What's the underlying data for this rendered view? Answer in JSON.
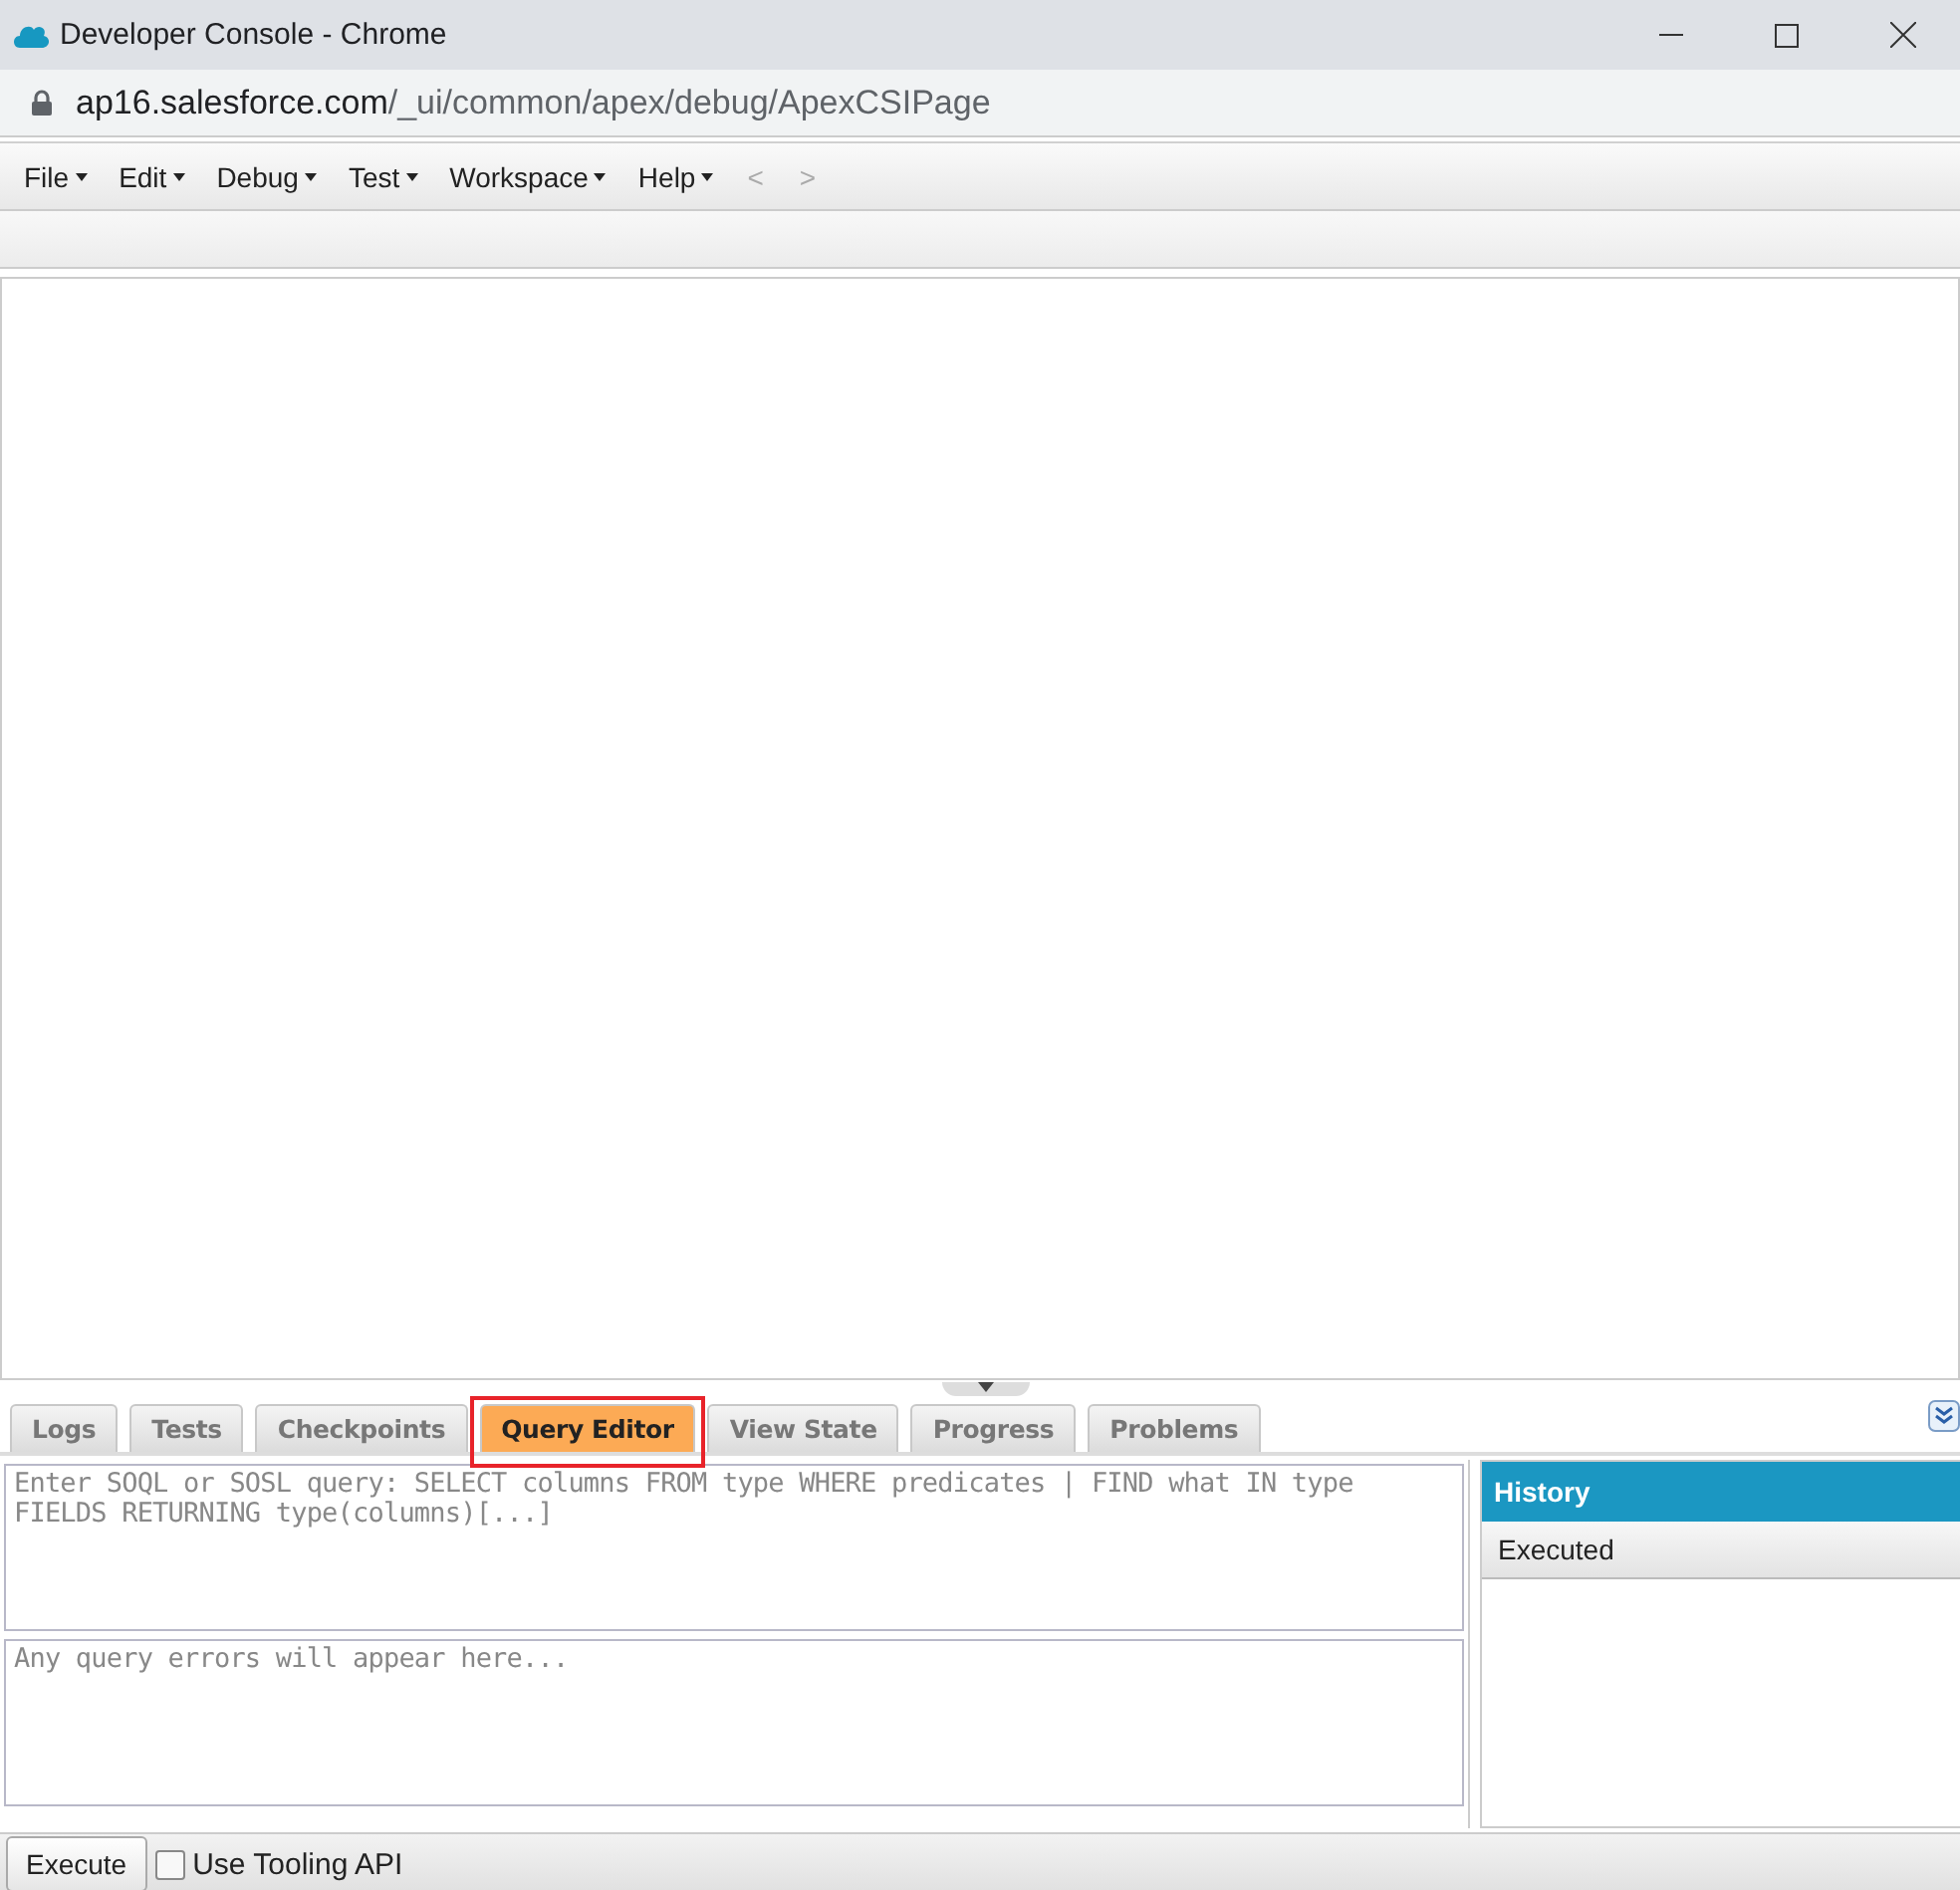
{
  "window": {
    "title": "Developer Console - Chrome",
    "url_host": "ap16.salesforce.com",
    "url_path": "/_ui/common/apex/debug/ApexCSIPage"
  },
  "menu": [
    {
      "label": "File"
    },
    {
      "label": "Edit"
    },
    {
      "label": "Debug"
    },
    {
      "label": "Test"
    },
    {
      "label": "Workspace"
    },
    {
      "label": "Help"
    }
  ],
  "nav": [
    {
      "label": "<",
      "disabled": true
    },
    {
      "label": ">",
      "disabled": true
    }
  ],
  "tabs": [
    {
      "label": "Logs",
      "selected": false,
      "highlighted": false
    },
    {
      "label": "Tests",
      "selected": false,
      "highlighted": false
    },
    {
      "label": "Checkpoints",
      "selected": false,
      "highlighted": false
    },
    {
      "label": "Query Editor",
      "selected": true,
      "highlighted": true
    },
    {
      "label": "View State",
      "selected": false,
      "highlighted": false
    },
    {
      "label": "Progress",
      "selected": false,
      "highlighted": false
    },
    {
      "label": "Problems",
      "selected": false,
      "highlighted": false
    }
  ],
  "query": {
    "placeholder": "Enter SOQL or SOSL query: SELECT columns FROM type WHERE predicates | FIND what IN type FIELDS RETURNING type(columns)[...]"
  },
  "errors": {
    "placeholder": "Any query errors will appear here..."
  },
  "history": {
    "title": "History",
    "columns": [
      "Executed"
    ]
  },
  "footer": {
    "button": "Execute",
    "checkbox": {
      "label": "Use Tooling API",
      "checked": false
    }
  }
}
